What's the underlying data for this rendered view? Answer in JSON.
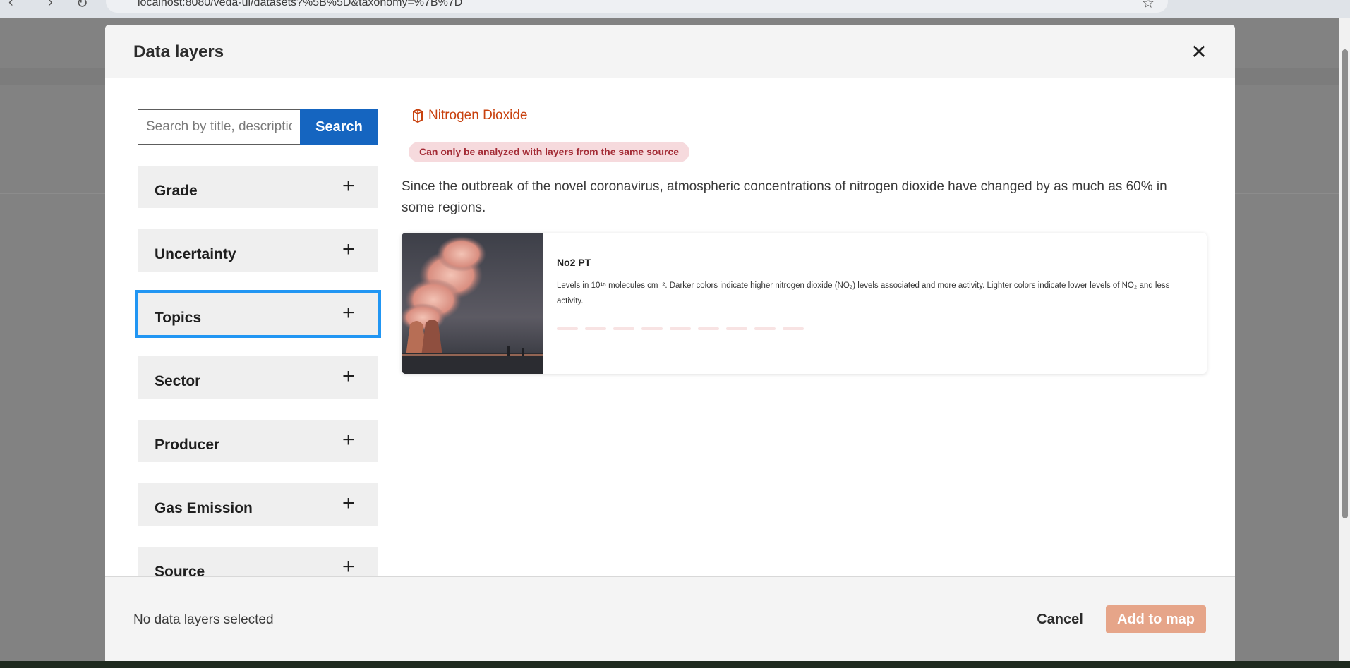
{
  "browser": {
    "url": "localhost:8080/veda-ui/datasets?%5B%5D&taxonomy=%7B%7D",
    "back_icon": "back-arrow-icon",
    "forward_icon": "forward-arrow-icon",
    "reload_icon": "reload-icon"
  },
  "modal": {
    "title": "Data layers",
    "close_icon": "close-icon"
  },
  "search": {
    "placeholder": "Search by title, description",
    "button_label": "Search"
  },
  "filters": [
    {
      "label": "Grade"
    },
    {
      "label": "Uncertainty"
    },
    {
      "label": "Topics"
    },
    {
      "label": "Sector"
    },
    {
      "label": "Producer"
    },
    {
      "label": "Gas Emission"
    },
    {
      "label": "Source"
    }
  ],
  "dataset": {
    "title": "Nitrogen Dioxide",
    "icon": "layers-icon",
    "badge": "Can only be analyzed with layers from the same source",
    "description": "Since the outbreak of the novel coronavirus, atmospheric concentrations of nitrogen dioxide have changed by as much as 60% in some regions.",
    "layer": {
      "title": "No2 PT",
      "description": "Levels in 10¹⁵ molecules cm⁻². Darker colors indicate higher nitrogen dioxide (NO₂) levels associated and more activity. Lighter colors indicate lower levels of NO₂ and less activity.",
      "image": "power-plant-cooling-towers-image"
    }
  },
  "footer": {
    "status": "No data layers selected",
    "cancel_label": "Cancel",
    "add_label": "Add to map"
  },
  "colors": {
    "accent": "#c8410e",
    "search_button": "#1565c0",
    "add_button_disabled": "#e6a589",
    "badge_bg": "#f6dadd",
    "badge_text": "#a32b35",
    "focus_ring": "#2196f3"
  }
}
